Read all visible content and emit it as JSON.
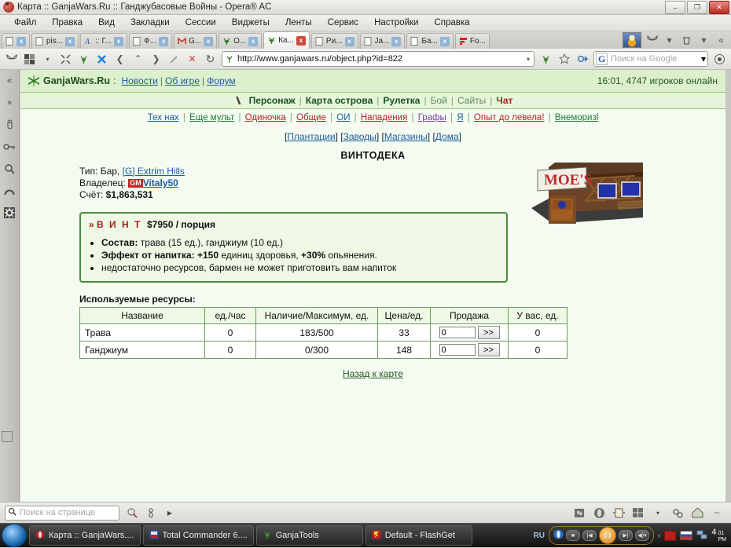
{
  "window": {
    "title": "Карта :: GanjaWars.Ru :: Ганджубасовые Войны - Opera® AC",
    "minimize": "–",
    "restore": "❐",
    "close": "✕"
  },
  "menubar": [
    "Файл",
    "Правка",
    "Вид",
    "Закладки",
    "Сессии",
    "Виджеты",
    "Ленты",
    "Сервис",
    "Настройки",
    "Справка"
  ],
  "tabs": [
    {
      "label": "",
      "icon": "blank-page-icon",
      "close": "x"
    },
    {
      "label": "pis...",
      "icon": "blank-page-icon",
      "close": "x"
    },
    {
      "label": ":: Г...",
      "icon": "script-A-icon",
      "close": "x"
    },
    {
      "label": "Ф...",
      "icon": "blank-page-icon",
      "close": "x"
    },
    {
      "label": "G...",
      "icon": "gmail-icon",
      "close": "x"
    },
    {
      "label": "О...",
      "icon": "leaf-icon",
      "close": "x"
    },
    {
      "label": "Ка...",
      "icon": "leaf-icon",
      "close": "x",
      "active": true
    },
    {
      "label": "Ри...",
      "icon": "blank-page-icon",
      "close": "x"
    },
    {
      "label": "Ja...",
      "icon": "blank-page-icon",
      "close": "x"
    },
    {
      "label": "Ба...",
      "icon": "blank-page-icon",
      "close": "x"
    },
    {
      "label": "Fo...",
      "icon": "flashget-icon",
      "close": ""
    }
  ],
  "tabbar_right": {
    "thumbnail": "clown-thumbnail",
    "butterfly": "butterfly-icon",
    "trash": "trash-icon",
    "collapse": "«"
  },
  "toolbar": {
    "icons": [
      "butterfly-icon",
      "panels-icon",
      "fit-icon",
      "leaf-icon",
      "x-mail-icon",
      "back-icon",
      "up-icon",
      "forward-icon",
      "edit-icon",
      "stop-icon",
      "reload-icon"
    ],
    "back": "❮",
    "up": "⌃",
    "forward": "❯",
    "stop": "✕",
    "reload": "↻",
    "address": {
      "url": "http://www.ganjawars.ru/object.php?id=822",
      "dropdown": "▾",
      "favicon": "leaf-icon"
    },
    "after_address_icons": [
      "leaf-icon",
      "star-icon",
      "wand-icon"
    ],
    "search": {
      "engine_badge": "G",
      "placeholder": "Поиск на Google",
      "dropdown": "▾"
    },
    "right_icon": "globe-icon"
  },
  "sidepanel": {
    "icons": [
      {
        "name": "collapse-left-icon",
        "glyph": "«"
      },
      {
        "name": "expand-right-icon",
        "glyph": "»"
      },
      {
        "name": "bookmarks-icon",
        "glyph": "▯"
      },
      {
        "name": "key-icon",
        "glyph": "⚿"
      },
      {
        "name": "search-icon",
        "glyph": "⌕"
      },
      {
        "name": "history-icon",
        "glyph": "⌒"
      },
      {
        "name": "settings-gear-icon",
        "glyph": "✺"
      }
    ]
  },
  "page": {
    "site_logo": "GanjaWars.Ru",
    "logo_sep": ":",
    "header_links": [
      "Новости",
      "Об игре",
      "Форум"
    ],
    "online_status": "16:01, 4747 игроков онлайн",
    "nav": [
      {
        "label": "Персонаж",
        "style": "bold"
      },
      {
        "label": "Карта острова",
        "style": "bold"
      },
      {
        "label": "Рулетка",
        "style": "bold"
      },
      {
        "label": "Бой",
        "style": "dim"
      },
      {
        "label": "Сайты",
        "style": "dim"
      },
      {
        "label": "Чат",
        "style": "red"
      }
    ],
    "sublinks": [
      {
        "label": "Тех нах",
        "color": "#1a5c9e"
      },
      {
        "label": "Еще мульт",
        "color": "#1f7a33"
      },
      {
        "label": "Одиночка",
        "color": "#b22222"
      },
      {
        "label": "Общие",
        "color": "#b22222"
      },
      {
        "label": "ОИ",
        "color": "#1a5c9e"
      },
      {
        "label": "Нападения",
        "color": "#b22222"
      },
      {
        "label": "Графы",
        "color": "#7a3fa0"
      },
      {
        "label": "Я",
        "color": "#1a5c9e"
      },
      {
        "label": "Опыт до левела!",
        "color": "#b22222"
      },
      {
        "label": "Внеморизl",
        "color": "#1f7a33"
      }
    ],
    "categories": [
      "Плантации",
      "Заводы",
      "Магазины",
      "Дома"
    ],
    "object": {
      "title": "ВИНТОДЕКА",
      "type_label": "Тип:",
      "type_value": "Бар,",
      "clan_link": "[G] Extrim Hills",
      "owner_label": "Владелец:",
      "owner_badge": "GM",
      "owner_name": "Vitaly50",
      "account_label": "Счёт:",
      "account_value": "$1,863,531",
      "building_image": "moes-tavern-building",
      "building_sign": "MOE'S"
    },
    "drink": {
      "chevron": "»",
      "name": "В И Н Т",
      "price": "$7950 / порция",
      "lines": [
        {
          "bold": "Состав:",
          "rest": " трава (15 ед.), ганджиум (10 ед.)"
        },
        {
          "bold": "Эффект от напитка:",
          "rest": " +150 единиц здоровья, +30% опьянения.",
          "bold2": "+150",
          "bold3": "+30%"
        },
        {
          "bold": "",
          "rest": "недостаточно ресурсов, бармен не может приготовить вам напиток"
        }
      ],
      "line2_prefix": "Эффект от напитка:",
      "line2_a": "+150",
      "line2_b": " единиц здоровья, ",
      "line2_c": "+30%",
      "line2_d": " опьянения.",
      "line3": "недостаточно ресурсов, бармен не может приготовить вам напиток"
    },
    "resources": {
      "title": "Используемые ресурсы:",
      "columns": [
        "Название",
        "ед./час",
        "Наличие/Максимум, ед.",
        "Цена/ед.",
        "Продажа",
        "У вас, ед."
      ],
      "rows": [
        {
          "name": "Трава",
          "per_hour": "0",
          "stock": "183/500",
          "price": "33",
          "sell_value": "0",
          "sell_button": ">>",
          "you_have": "0"
        },
        {
          "name": "Ганджиум",
          "per_hour": "0",
          "stock": "0/300",
          "price": "148",
          "sell_value": "0",
          "sell_button": ">>",
          "you_have": "0"
        }
      ]
    },
    "back_link": "Назад к карте"
  },
  "findbar": {
    "search_icon": "search-icon",
    "placeholder": "Поиск на странице",
    "find_next_icon": "find-icon",
    "person_icon": "person-icon",
    "play_icon": "▶",
    "right_icons": [
      "transfer-icon",
      "opera-icon",
      "panel-icon",
      "tile-icon",
      "zoom-icon",
      "minus-icon"
    ],
    "minus": "–"
  },
  "taskbar": {
    "start": "start-orb",
    "items": [
      {
        "label": "Карта :: GanjaWars....",
        "icon": "opera-icon"
      },
      {
        "label": "Total Commander 6....",
        "icon": "total-commander-icon"
      },
      {
        "label": "GanjaTools",
        "icon": "leaf-icon"
      },
      {
        "label": "Default - FlashGet",
        "icon": "flashget-icon"
      }
    ],
    "tray": {
      "layout": "RU",
      "player_icons": [
        "opera-icon",
        "stop",
        "prev",
        "pause",
        "next",
        "volume"
      ],
      "chevron": "‹",
      "flag1": "red-flag-icon",
      "flag2": "russia-flag-icon",
      "network": "network-icon"
    },
    "clock_time": "4",
    "clock_min": "01",
    "clock_ampm": "PM"
  }
}
